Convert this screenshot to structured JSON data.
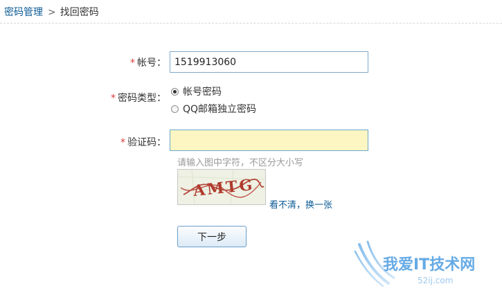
{
  "breadcrumb": {
    "parent": "密码管理",
    "separator": ">",
    "current": "找回密码"
  },
  "form": {
    "required_mark": "*",
    "account": {
      "label": "帐号：",
      "value": "1519913060"
    },
    "password_type": {
      "label": "密码类型：",
      "options": [
        {
          "label": "帐号密码",
          "checked": true
        },
        {
          "label": "QQ邮箱独立密码",
          "checked": false
        }
      ]
    },
    "captcha": {
      "label": "验证码：",
      "value": "",
      "hint": "请输入图中字符，不区分大小写",
      "image_text": "AMTG",
      "refresh_label": "看不清，换一张"
    },
    "next_button_label": "下一步"
  },
  "watermark": {
    "text": "我爱IT技术网",
    "subtext": "52ij.com"
  },
  "colors": {
    "link": "#0b5a96",
    "required": "#d83a3a",
    "captcha_field_bg": "#fdf6c3",
    "input_border": "#7fa9c9",
    "hint": "#999999"
  }
}
